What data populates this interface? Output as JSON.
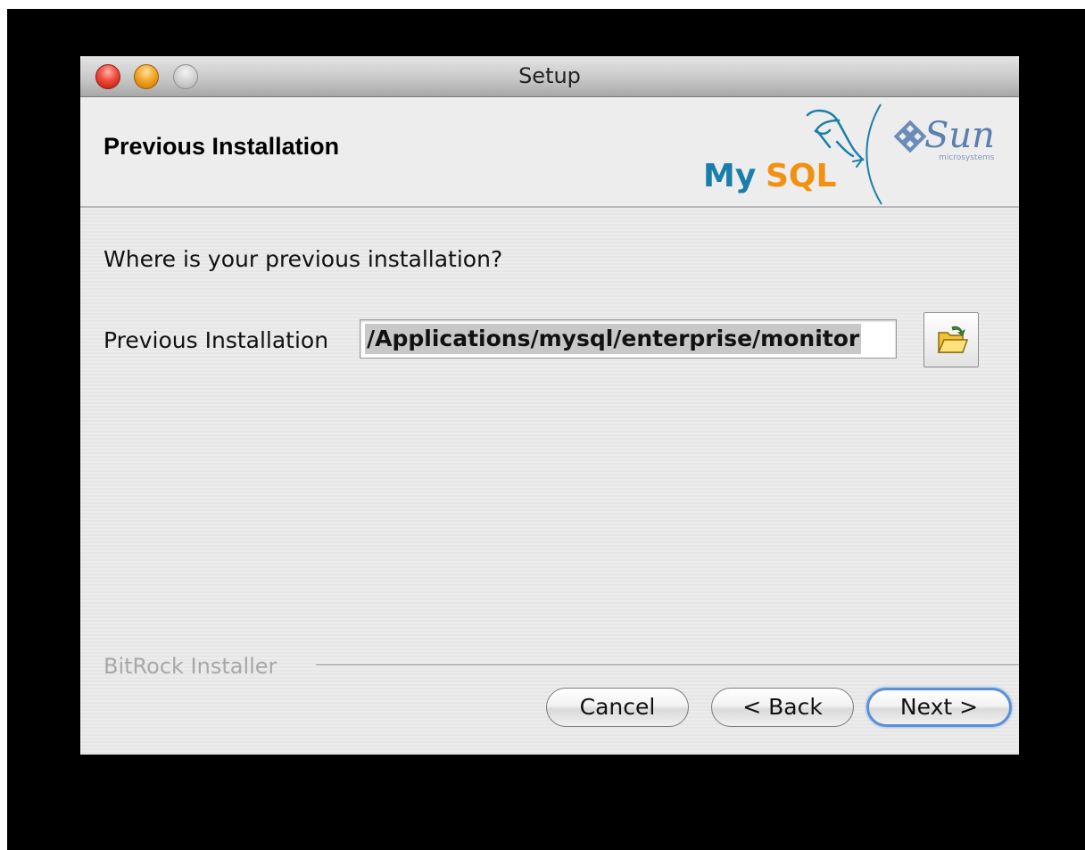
{
  "window": {
    "title": "Setup"
  },
  "header": {
    "heading": "Previous Installation",
    "logos": {
      "mysql": "MySQL",
      "sun": "Sun",
      "sun_sub": "microsystems"
    }
  },
  "main": {
    "question": "Where is your previous installation?",
    "field_label": "Previous Installation",
    "path_value": "/Applications/mysql/enterprise/monitor"
  },
  "footer": {
    "installer_label": "BitRock Installer",
    "buttons": {
      "cancel": "Cancel",
      "back": "< Back",
      "next": "Next >"
    }
  },
  "colors": {
    "mysql_blue": "#1a7fa8",
    "mysql_orange": "#f29111",
    "sun_blue": "#5a7fb0",
    "default_button": "#5b8fd6"
  }
}
